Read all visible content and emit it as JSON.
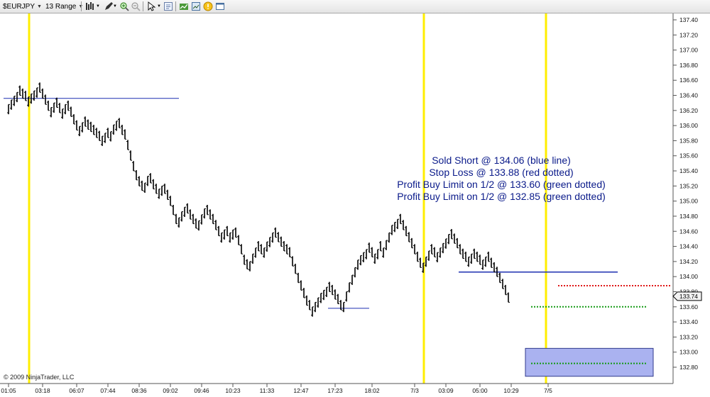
{
  "toolbar": {
    "instrument": "$EURJPY",
    "period": "13 Range",
    "icons": [
      "bar-style-icon",
      "draw-pencil-icon",
      "zoom-in-icon",
      "zoom-out-icon",
      "cursor-icon",
      "properties-icon",
      "strategy-icon",
      "data-box-icon",
      "alert-icon",
      "window-icon"
    ]
  },
  "copyright": "© 2009 NinjaTrader, LLC",
  "annotation": {
    "lines": [
      "Sold Short @ 134.06 (blue line)",
      "Stop Loss @ 133.88 (red dotted)",
      "Profit Buy Limit on 1/2 @  133.60 (green dotted)",
      "Profit Buy Limit on 1/2 @ 132.85 (green dotted)"
    ],
    "color": "#0a1a8a"
  },
  "chart_data": {
    "type": "bar",
    "instrument": "$EURJPY",
    "period": "13 Range",
    "price_axis": {
      "ticks": [
        "137.40",
        "137.20",
        "137.00",
        "136.80",
        "136.60",
        "136.40",
        "136.20",
        "136.00",
        "135.80",
        "135.60",
        "135.40",
        "135.20",
        "135.00",
        "134.80",
        "134.60",
        "134.40",
        "134.20",
        "134.00",
        "133.80",
        "133.60",
        "133.40",
        "133.20",
        "133.00",
        "132.80"
      ],
      "min": 132.7,
      "max": 137.45
    },
    "current_price_label": "133.74",
    "time_axis": {
      "labels": [
        "01:05",
        "03:18",
        "06:07",
        "07:44",
        "08:36",
        "09:02",
        "09:46",
        "10:23",
        "11:33",
        "12:47",
        "17:23",
        "18:02",
        "7/3",
        "03:09",
        "05:00",
        "10:29",
        "7/5"
      ],
      "label_bar_index": [
        0,
        12,
        24,
        35,
        46,
        57,
        68,
        79,
        91,
        103,
        115,
        128,
        143,
        154,
        166,
        177,
        190
      ]
    },
    "bar_closes": [
      136.28,
      136.34,
      136.39,
      136.44,
      136.4,
      136.36,
      136.33,
      136.38,
      136.42,
      136.46,
      136.5,
      136.44,
      136.36,
      136.28,
      136.2,
      136.24,
      136.3,
      136.24,
      136.17,
      136.22,
      136.28,
      136.2,
      136.12,
      136.02,
      135.94,
      135.99,
      136.04,
      135.99,
      135.95,
      135.92,
      135.88,
      135.84,
      135.8,
      135.86,
      135.9,
      135.84,
      135.92,
      136.01,
      136.06,
      135.97,
      135.88,
      135.82,
      135.68,
      135.54,
      135.4,
      135.28,
      135.2,
      135.14,
      135.24,
      135.33,
      135.24,
      135.16,
      135.1,
      135.16,
      135.2,
      135.1,
      135.02,
      134.94,
      134.82,
      134.7,
      134.78,
      134.86,
      134.92,
      134.84,
      134.76,
      134.7,
      134.64,
      134.74,
      134.82,
      134.9,
      134.82,
      134.76,
      134.7,
      134.62,
      134.54,
      134.58,
      134.62,
      134.54,
      134.58,
      134.62,
      134.52,
      134.42,
      134.3,
      134.16,
      134.1,
      134.2,
      134.3,
      134.38,
      134.34,
      134.3,
      134.38,
      134.46,
      134.52,
      134.58,
      134.52,
      134.46,
      134.4,
      134.34,
      134.3,
      134.26,
      134.14,
      134.04,
      133.92,
      133.82,
      133.72,
      133.62,
      133.56,
      133.6,
      133.66,
      133.72,
      133.78,
      133.82,
      133.86,
      133.8,
      133.76,
      133.7,
      133.64,
      133.56,
      133.66,
      133.8,
      133.92,
      134.02,
      134.12,
      134.22,
      134.28,
      134.32,
      134.36,
      134.32,
      134.26,
      134.3,
      134.36,
      134.34,
      134.38,
      134.48,
      134.58,
      134.68,
      134.72,
      134.76,
      134.7,
      134.62,
      134.54,
      134.46,
      134.38,
      134.3,
      134.2,
      134.12,
      134.18,
      134.26,
      134.34,
      134.3,
      134.26,
      134.32,
      134.38,
      134.44,
      134.5,
      134.56,
      134.5,
      134.44,
      134.38,
      134.3,
      134.24,
      134.2,
      134.26,
      134.3,
      134.24,
      134.2,
      134.16,
      134.22,
      134.26,
      134.2,
      134.12,
      134.06,
      134.0,
      133.92,
      133.84,
      133.76,
      133.66
    ],
    "levels": [
      {
        "label": "Sold Short",
        "price": 134.06,
        "style": "solid",
        "color": "#1c2fb0"
      },
      {
        "label": "Stop Loss",
        "price": 133.88,
        "style": "dotted",
        "color": "#e01818"
      },
      {
        "label": "Profit Buy Limit 1",
        "price": 133.6,
        "style": "dotted",
        "color": "#139a13"
      },
      {
        "label": "Profit Buy Limit 2",
        "price": 132.85,
        "style": "dotted",
        "color": "#139a13"
      }
    ],
    "session_break_color": "#ffee00",
    "target_box_color": "#aab2f0"
  }
}
